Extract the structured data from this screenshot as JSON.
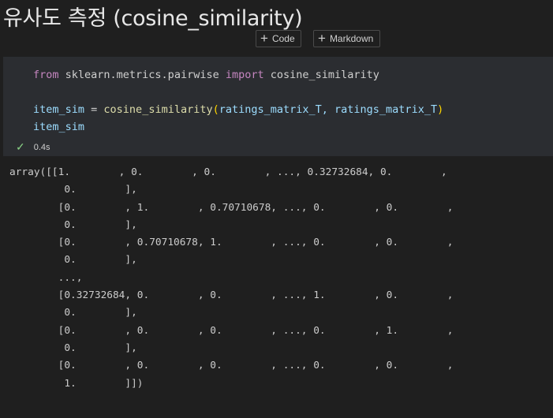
{
  "heading": "유사도 측정 (cosine_similarity)",
  "cell_toolbar": {
    "add_code_label": "Code",
    "add_markdown_label": "Markdown"
  },
  "code": {
    "line1": {
      "from": "from",
      "module": " sklearn.metrics.pairwise ",
      "import": "import",
      "name": " cosine_similarity"
    },
    "line2": {
      "var": "item_sim",
      "eq": " = ",
      "fn": "cosine_similarity",
      "open": "(",
      "args": "ratings_matrix_T, ratings_matrix_T",
      "close": ")"
    },
    "line3": "item_sim"
  },
  "execution": {
    "status_icon": "check-icon",
    "duration": "0.4s"
  },
  "output": {
    "lines": [
      "array([[1.        , 0.        , 0.        , ..., 0.32732684, 0.        ,",
      "         0.        ],",
      "        [0.        , 1.        , 0.70710678, ..., 0.        , 0.        ,",
      "         0.        ],",
      "        [0.        , 0.70710678, 1.        , ..., 0.        , 0.        ,",
      "         0.        ],",
      "        ...,",
      "        [0.32732684, 0.        , 0.        , ..., 1.        , 0.        ,",
      "         0.        ],",
      "        [0.        , 0.        , 0.        , ..., 0.        , 1.        ,",
      "         0.        ],",
      "        [0.        , 0.        , 0.        , ..., 0.        , 0.        ,",
      "         1.        ]])"
    ]
  },
  "colors": {
    "background": "#1f1f1f",
    "cell_background": "#2b2d31",
    "keyword": "#c586c0",
    "function": "#dcdcaa",
    "variable": "#9cdcfe",
    "bracket": "#ffd700",
    "success": "#89d185"
  }
}
